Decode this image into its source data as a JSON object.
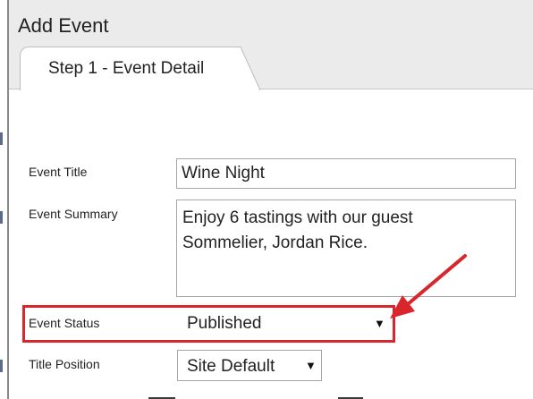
{
  "dialog": {
    "title": "Add Event"
  },
  "tabs": [
    {
      "label": "Step 1 - Event Detail",
      "active": true
    }
  ],
  "form": {
    "event_title": {
      "label": "Event Title",
      "value": "Wine Night"
    },
    "event_summary": {
      "label": "Event Summary",
      "value": "Enjoy 6 tastings with our guest\nSommelier, Jordan Rice."
    },
    "event_status": {
      "label": "Event Status",
      "value": "Published",
      "arrow": "▼"
    },
    "title_position": {
      "label": "Title Position",
      "value": "Site Default",
      "arrow": "▼"
    }
  },
  "annotation": {
    "color": "#d9262d",
    "target": "event-status"
  }
}
